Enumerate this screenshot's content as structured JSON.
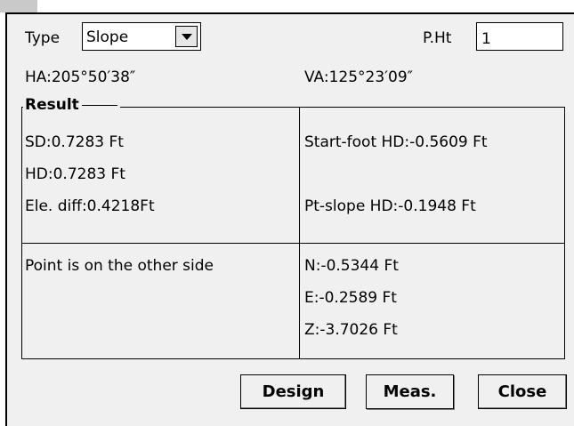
{
  "form": {
    "type_label": "Type",
    "type_value": "Slope",
    "pht_label": "P.Ht",
    "pht_value": "1",
    "ha": "HA:205°50′38″",
    "va": "VA:125°23′09″"
  },
  "result": {
    "legend": "Result",
    "sd": "SD:0.7283 Ft",
    "hd": "HD:0.7283 Ft",
    "ele_diff": "Ele. diff:0.4218Ft",
    "start_foot_hd": "Start-foot HD:-0.5609 Ft",
    "pt_slope_hd": "Pt-slope HD:-0.1948 Ft",
    "side_message": "Point is on the other side",
    "n": "N:-0.5344 Ft",
    "e": "E:-0.2589 Ft",
    "z": "Z:-3.7026 Ft"
  },
  "buttons": {
    "design": "Design",
    "meas": "Meas.",
    "close": "Close"
  },
  "icons": {
    "dropdown": "chevron-down-icon"
  }
}
